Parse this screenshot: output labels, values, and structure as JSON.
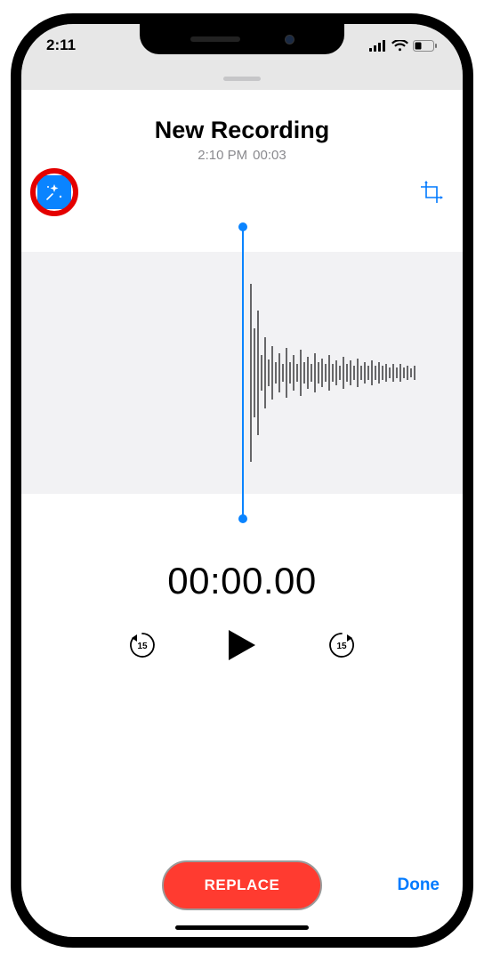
{
  "status": {
    "time": "2:11"
  },
  "header": {
    "title": "New Recording",
    "timestamp": "2:10 PM",
    "duration": "00:03"
  },
  "playback": {
    "timer": "00:00.00",
    "skip_seconds": "15"
  },
  "footer": {
    "replace_label": "REPLACE",
    "done_label": "Done"
  }
}
